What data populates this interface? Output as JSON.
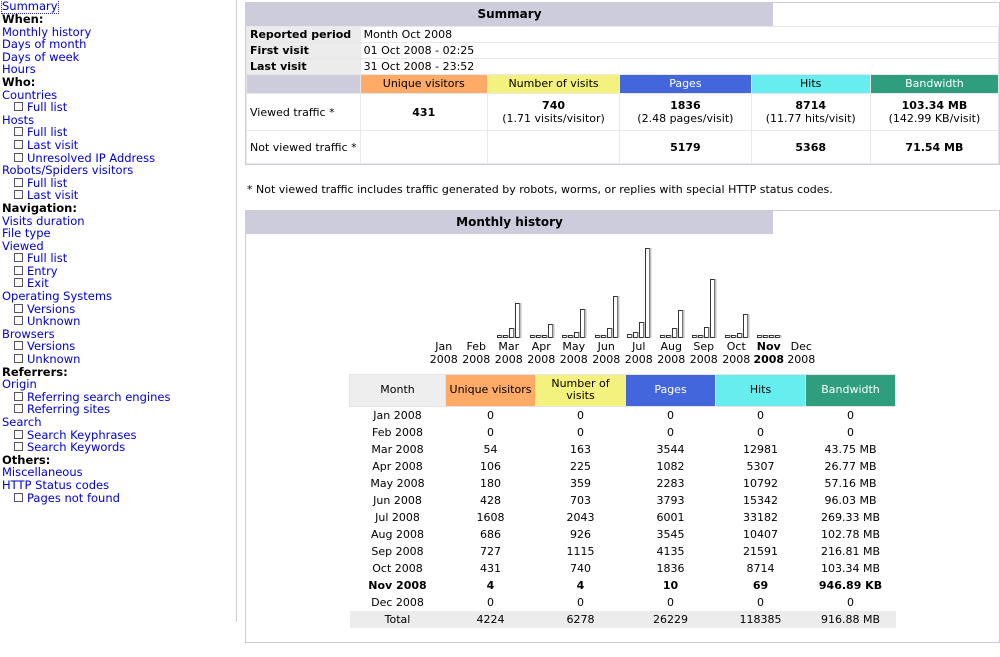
{
  "sidebar": {
    "top_link": "Summary",
    "sections": [
      {
        "heading": "When:",
        "items": [
          {
            "label": "Monthly history",
            "sub": false
          },
          {
            "label": "Days of month",
            "sub": false
          },
          {
            "label": "Days of week",
            "sub": false
          },
          {
            "label": "Hours",
            "sub": false
          }
        ]
      },
      {
        "heading": "Who:",
        "items": [
          {
            "label": "Countries",
            "sub": false
          },
          {
            "label": "Full list",
            "sub": true
          },
          {
            "label": "Hosts",
            "sub": false
          },
          {
            "label": "Full list",
            "sub": true
          },
          {
            "label": "Last visit",
            "sub": true
          },
          {
            "label": "Unresolved IP Address",
            "sub": true
          },
          {
            "label": "Robots/Spiders visitors",
            "sub": false
          },
          {
            "label": "Full list",
            "sub": true
          },
          {
            "label": "Last visit",
            "sub": true
          }
        ]
      },
      {
        "heading": "Navigation:",
        "items": [
          {
            "label": "Visits duration",
            "sub": false
          },
          {
            "label": "File type",
            "sub": false
          },
          {
            "label": "Viewed",
            "sub": false
          },
          {
            "label": "Full list",
            "sub": true
          },
          {
            "label": "Entry",
            "sub": true
          },
          {
            "label": "Exit",
            "sub": true
          },
          {
            "label": "Operating Systems",
            "sub": false
          },
          {
            "label": "Versions",
            "sub": true
          },
          {
            "label": "Unknown",
            "sub": true
          },
          {
            "label": "Browsers",
            "sub": false
          },
          {
            "label": "Versions",
            "sub": true
          },
          {
            "label": "Unknown",
            "sub": true
          }
        ]
      },
      {
        "heading": "Referrers:",
        "items": [
          {
            "label": "Origin",
            "sub": false
          },
          {
            "label": "Referring search engines",
            "sub": true
          },
          {
            "label": "Referring sites",
            "sub": true
          },
          {
            "label": "Search",
            "sub": false
          },
          {
            "label": "Search Keyphrases",
            "sub": true
          },
          {
            "label": "Search Keywords",
            "sub": true
          }
        ]
      },
      {
        "heading": "Others:",
        "items": [
          {
            "label": "Miscellaneous",
            "sub": false
          },
          {
            "label": "HTTP Status codes",
            "sub": false
          },
          {
            "label": "Pages not found",
            "sub": true
          }
        ]
      }
    ]
  },
  "summary": {
    "title": "Summary",
    "rows": [
      {
        "label": "Reported period",
        "value": "Month Oct 2008"
      },
      {
        "label": "First visit",
        "value": "01 Oct 2008 - 02:25"
      },
      {
        "label": "Last visit",
        "value": "31 Oct 2008 - 23:52"
      }
    ],
    "columns": [
      {
        "label": "Unique visitors",
        "color": "#FFAA66"
      },
      {
        "label": "Number of visits",
        "color": "#F4F27E"
      },
      {
        "label": "Pages",
        "color": "#4466DD"
      },
      {
        "label": "Hits",
        "color": "#66EEEE"
      },
      {
        "label": "Bandwidth",
        "color": "#2E9E7E"
      }
    ],
    "viewed_label": "Viewed traffic *",
    "viewed": [
      {
        "main": "431",
        "sub": ""
      },
      {
        "main": "740",
        "sub": "(1.71 visits/visitor)"
      },
      {
        "main": "1836",
        "sub": "(2.48 pages/visit)"
      },
      {
        "main": "8714",
        "sub": "(11.77 hits/visit)"
      },
      {
        "main": "103.34 MB",
        "sub": "(142.99 KB/visit)"
      }
    ],
    "notviewed_label": "Not viewed traffic *",
    "notviewed": [
      {
        "main": "",
        "sub": ""
      },
      {
        "main": "",
        "sub": ""
      },
      {
        "main": "5179",
        "sub": ""
      },
      {
        "main": "5368",
        "sub": ""
      },
      {
        "main": "71.54 MB",
        "sub": ""
      }
    ],
    "footnote": "* Not viewed traffic includes traffic generated by robots, worms, or replies with special HTTP status codes."
  },
  "monthly": {
    "title": "Monthly history",
    "columns": [
      {
        "label": "Month",
        "color": "#EEEEEE",
        "text": "#000000"
      },
      {
        "label": "Unique visitors",
        "color": "#FFAA66",
        "text": "#000000"
      },
      {
        "label": "Number of visits",
        "color": "#F4F27E",
        "text": "#000000"
      },
      {
        "label": "Pages",
        "color": "#4466DD",
        "text": "#FFFFFF"
      },
      {
        "label": "Hits",
        "color": "#66EEEE",
        "text": "#000000"
      },
      {
        "label": "Bandwidth",
        "color": "#2E9E7E",
        "text": "#FFFFFF"
      }
    ],
    "rows": [
      {
        "month": "Jan 2008",
        "unique": "0",
        "visits": "0",
        "pages": "0",
        "hits": "0",
        "bandwidth": "0",
        "current": false
      },
      {
        "month": "Feb 2008",
        "unique": "0",
        "visits": "0",
        "pages": "0",
        "hits": "0",
        "bandwidth": "0",
        "current": false
      },
      {
        "month": "Mar 2008",
        "unique": "54",
        "visits": "163",
        "pages": "3544",
        "hits": "12981",
        "bandwidth": "43.75 MB",
        "current": false
      },
      {
        "month": "Apr 2008",
        "unique": "106",
        "visits": "225",
        "pages": "1082",
        "hits": "5307",
        "bandwidth": "26.77 MB",
        "current": false
      },
      {
        "month": "May 2008",
        "unique": "180",
        "visits": "359",
        "pages": "2283",
        "hits": "10792",
        "bandwidth": "57.16 MB",
        "current": false
      },
      {
        "month": "Jun 2008",
        "unique": "428",
        "visits": "703",
        "pages": "3793",
        "hits": "15342",
        "bandwidth": "96.03 MB",
        "current": false
      },
      {
        "month": "Jul 2008",
        "unique": "1608",
        "visits": "2043",
        "pages": "6001",
        "hits": "33182",
        "bandwidth": "269.33 MB",
        "current": false
      },
      {
        "month": "Aug 2008",
        "unique": "686",
        "visits": "926",
        "pages": "3545",
        "hits": "10407",
        "bandwidth": "102.78 MB",
        "current": false
      },
      {
        "month": "Sep 2008",
        "unique": "727",
        "visits": "1115",
        "pages": "4135",
        "hits": "21591",
        "bandwidth": "216.81 MB",
        "current": false
      },
      {
        "month": "Oct 2008",
        "unique": "431",
        "visits": "740",
        "pages": "1836",
        "hits": "8714",
        "bandwidth": "103.34 MB",
        "current": false
      },
      {
        "month": "Nov 2008",
        "unique": "4",
        "visits": "4",
        "pages": "10",
        "hits": "69",
        "bandwidth": "946.89 KB",
        "current": true
      },
      {
        "month": "Dec 2008",
        "unique": "0",
        "visits": "0",
        "pages": "0",
        "hits": "0",
        "bandwidth": "0",
        "current": false
      }
    ],
    "total": {
      "month": "Total",
      "unique": "4224",
      "visits": "6278",
      "pages": "26229",
      "hits": "118385",
      "bandwidth": "916.88 MB"
    }
  },
  "chart_data": {
    "type": "bar",
    "title": "Monthly history",
    "xlabel": "",
    "ylabel": "",
    "grid": false,
    "legend_position": "none",
    "categories": [
      "Jan 2008",
      "Feb 2008",
      "Mar 2008",
      "Apr 2008",
      "May 2008",
      "Jun 2008",
      "Jul 2008",
      "Aug 2008",
      "Sep 2008",
      "Oct 2008",
      "Nov 2008",
      "Dec 2008"
    ],
    "series": [
      {
        "name": "Unique visitors",
        "color": "#FFAA66",
        "values": [
          0,
          0,
          54,
          106,
          180,
          428,
          1608,
          686,
          727,
          431,
          4,
          0
        ]
      },
      {
        "name": "Number of visits",
        "color": "#F4F27E",
        "values": [
          0,
          0,
          163,
          225,
          359,
          703,
          2043,
          926,
          1115,
          740,
          4,
          0
        ]
      },
      {
        "name": "Pages",
        "color": "#4466DD",
        "values": [
          0,
          0,
          3544,
          1082,
          2283,
          3793,
          6001,
          3545,
          4135,
          1836,
          10,
          0
        ]
      },
      {
        "name": "Hits",
        "color": "#66EEEE",
        "values": [
          0,
          0,
          12981,
          5307,
          10792,
          15342,
          33182,
          10407,
          21591,
          8714,
          69,
          0
        ]
      }
    ],
    "ylim": [
      0,
      33182
    ],
    "note": "Each month shows four bars: unique visitors, visits, pages, hits. Bars rendered as white rectangles with dark outlines."
  }
}
